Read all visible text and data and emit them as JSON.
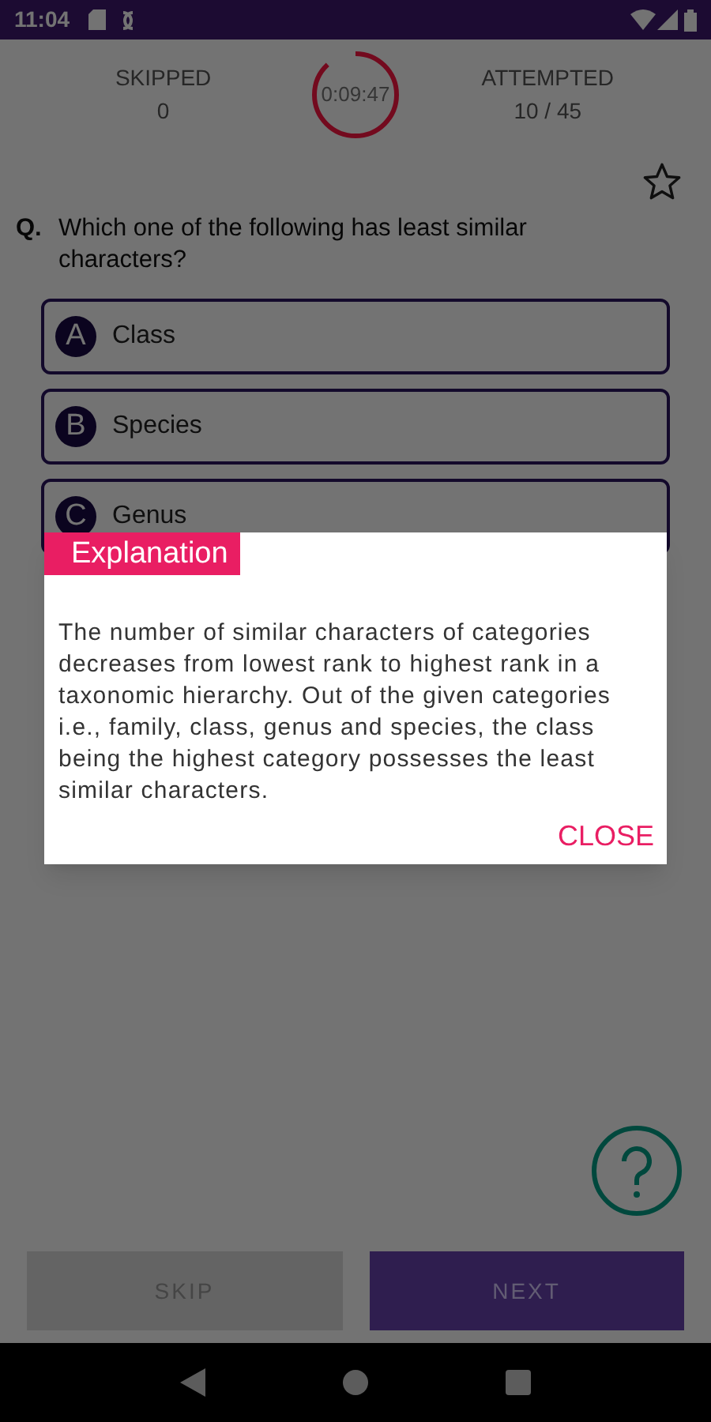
{
  "status_bar": {
    "time": "11:04"
  },
  "stats": {
    "skipped_label": "SKIPPED",
    "skipped_value": "0",
    "timer": {
      "text": "0:09:47",
      "level": 0.88
    },
    "attempted_label": "ATTEMPTED",
    "attempted_value": "10 / 45"
  },
  "bookmarked": false,
  "question": {
    "prefix": "Q.",
    "text": "Which one of the following has least similar characters?"
  },
  "options": [
    {
      "letter": "A",
      "text": "Class"
    },
    {
      "letter": "B",
      "text": "Species"
    },
    {
      "letter": "C",
      "text": "Genus"
    }
  ],
  "dialog": {
    "title": "Explanation",
    "body": "The number of similar characters of categories decreases from lowest rank to highest rank in a taxonomic hierarchy. Out of the given categories i.e., family, class, genus and species, the class being the highest category possesses the least similar characters.",
    "close": "CLOSE"
  },
  "buttons": [
    {
      "label": "SKIP",
      "kind": "secondary"
    },
    {
      "label": "NEXT",
      "kind": "primary"
    }
  ]
}
